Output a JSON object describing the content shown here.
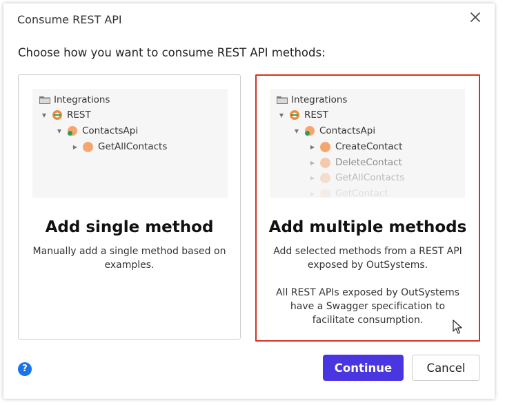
{
  "dialog": {
    "title": "Consume REST API",
    "prompt": "Choose how you want to consume REST API methods:",
    "help_label": "?"
  },
  "cards": {
    "single": {
      "tree": {
        "root": "Integrations",
        "rest": "REST",
        "api": "ContactsApi",
        "methods": [
          "GetAllContacts"
        ]
      },
      "title": "Add single method",
      "description": "Manually add a single method based on examples."
    },
    "multiple": {
      "tree": {
        "root": "Integrations",
        "rest": "REST",
        "api": "ContactsApi",
        "methods": [
          "CreateContact",
          "DeleteContact",
          "GetAllContacts",
          "GetContact"
        ]
      },
      "title": "Add multiple methods",
      "description": "Add selected methods from a REST API exposed by OutSystems.",
      "note": "All REST APIs exposed by OutSystems have a Swagger specification to facilitate consumption."
    }
  },
  "buttons": {
    "continue": "Continue",
    "cancel": "Cancel"
  },
  "colors": {
    "primary": "#4936e0",
    "selected_border": "#d4311f",
    "method_orb": "#f5a66f",
    "help": "#1a73e8"
  },
  "icons": [
    "close-icon",
    "folder-icon",
    "rest-icon",
    "api-icon",
    "method-icon",
    "caret-icon",
    "help-icon",
    "cursor-icon"
  ]
}
